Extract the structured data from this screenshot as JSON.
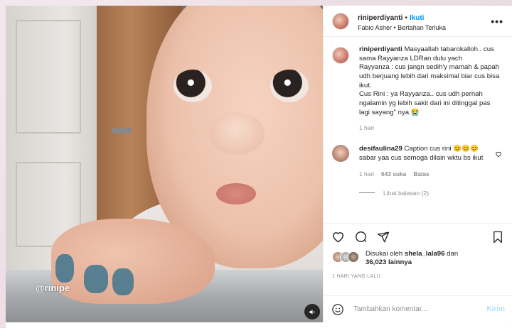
{
  "post": {
    "username": "riniperdiyanti",
    "follow_label": "Ikuti",
    "separator": "•",
    "subtitle": "Fabio Asher • Bertahan Terluka",
    "more_label": "•••",
    "watermark": "@rinipe"
  },
  "caption": {
    "username": "riniperdiyanti",
    "text": "Masyaallah tabarokalloh.. cus sama Rayyanza LDRan dulu yach",
    "line2": "Rayyanza : cus jangn sedih'y mamah & papah udh berjuang lebih dari maksimal biar cus bisa ikut.",
    "line3": "Cus Rini : ya Rayyanza.. cus udh pernah ngalamin yg lebih sakit dari ini ditinggal pas lagi sayang\" nya.😭",
    "time": "1 hari"
  },
  "comment": {
    "username": "desifaulina29",
    "text": "Caption cus rini 😊😊😊 sabar yaa cus semoga dilain wktu bs ikut",
    "time": "1 hari",
    "likes": "643 suka",
    "reply": "Balas",
    "view_replies": "Lihat balasan (2)"
  },
  "likes": {
    "prefix": "Disukai oleh",
    "user": "shela_lala96",
    "and": "dan",
    "count": "36,023",
    "suffix": "lainnya"
  },
  "timestamp": "1 HARI YANG LALU",
  "add_comment": {
    "placeholder": "Tambahkan komentar...",
    "post_label": "Kirim"
  },
  "icons": {
    "like": "heart-icon",
    "comment": "comment-icon",
    "share": "paper-plane-icon",
    "save": "bookmark-icon",
    "emoji": "emoji-icon",
    "audio": "speaker-icon"
  },
  "colors": {
    "accent": "#0095f6",
    "post_disabled": "#b2dffc",
    "muted": "#8e8e8e",
    "text": "#262626"
  }
}
